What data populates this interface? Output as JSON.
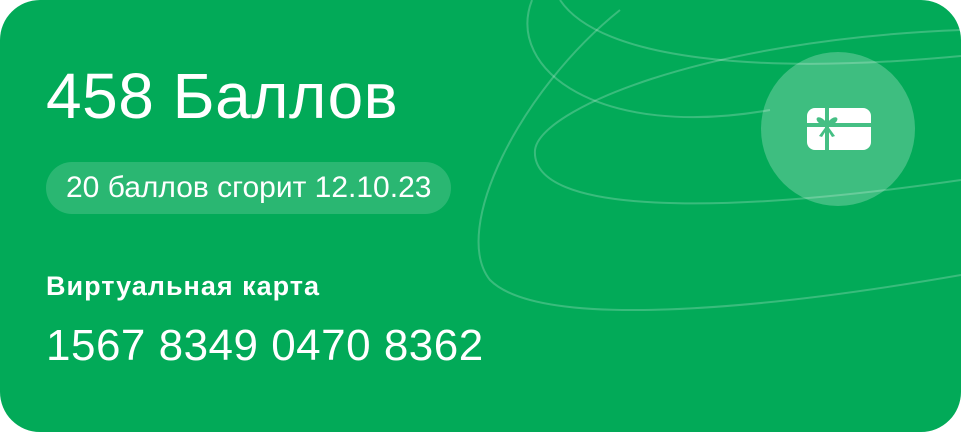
{
  "card": {
    "points_title": "458 Баллов",
    "expiry_note": "20 баллов сгорит 12.10.23",
    "virtual_card_label": "Виртуальная карта",
    "card_number": "1567 8349 0470 8362",
    "gift_icon": "gift-card-icon"
  },
  "colors": {
    "card_background": "#02AA58",
    "text": "#FFFFFF"
  }
}
